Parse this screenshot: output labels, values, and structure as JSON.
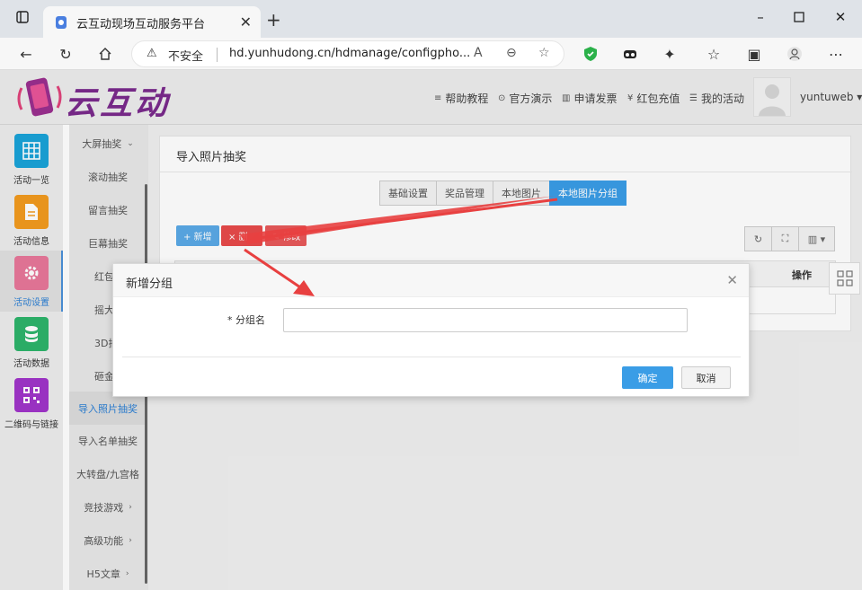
{
  "browser": {
    "tab_title": "云互动现场互动服务平台",
    "address_warning": "不安全",
    "url": "hd.yunhudong.cn/hdmanage/configpho..."
  },
  "header": {
    "logo_text": "云互动",
    "nav": [
      "帮助教程",
      "官方演示",
      "申请发票",
      "红包充值",
      "我的活动"
    ],
    "user": "yuntuweb ▾"
  },
  "sidebar": {
    "items": [
      {
        "label": "活动一览",
        "icon": "grid-icon",
        "color": "#1aa3d8"
      },
      {
        "label": "活动信息",
        "icon": "document-icon",
        "color": "#f29b1f"
      },
      {
        "label": "活动设置",
        "icon": "gear-icon",
        "color": "#e8779a"
      },
      {
        "label": "活动数据",
        "icon": "database-icon",
        "color": "#2db36b"
      },
      {
        "label": "二维码与链接",
        "icon": "qrcode-icon",
        "color": "#a035c9"
      }
    ]
  },
  "submenu": {
    "items": [
      "大屏抽奖",
      "滚动抽奖",
      "留言抽奖",
      "巨幕抽奖",
      "红包",
      "摇大",
      "3D抽",
      "砸金",
      "导入照片抽奖",
      "导入名单抽奖",
      "大转盘/九宫格",
      "竞技游戏",
      "高级功能",
      "H5文章"
    ]
  },
  "panel": {
    "title": "导入照片抽奖",
    "tabs": [
      "基础设置",
      "奖品管理",
      "本地图片",
      "本地图片分组"
    ],
    "actions": {
      "add": "+ 新增",
      "delete": "× 删",
      "edit": "✎ 修改"
    },
    "table_header_op": "操作"
  },
  "modal": {
    "title": "新增分组",
    "field_label": "* 分组名",
    "field_value": "",
    "ok": "确定",
    "cancel": "取消"
  },
  "colors": {
    "accent": "#3a9de6",
    "danger": "#e84a4a",
    "annotation": "#e84040"
  }
}
